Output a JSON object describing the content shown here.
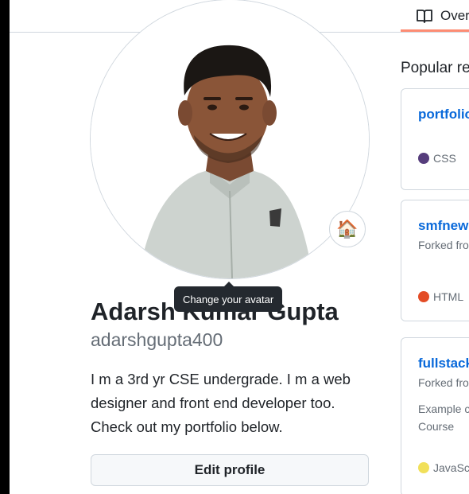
{
  "tab": {
    "label": "Overview",
    "icon": "book-icon"
  },
  "tooltip": "Change your avatar",
  "status": {
    "emoji": "🏠"
  },
  "profile": {
    "full_name": "Adarsh Kumar Gupta",
    "username": "adarshgupta400",
    "bio": "I m a 3rd yr CSE undergrade. I m a web designer and front end developer too. Check out my portfolio below.",
    "edit_label": "Edit profile"
  },
  "popular": {
    "title": "Popular repositories",
    "repos": [
      {
        "name": "portfolio",
        "forked": "",
        "description": "",
        "language": "CSS",
        "lang_color": "#563d7c"
      },
      {
        "name": "smfnew",
        "forked": "Forked from",
        "description": "",
        "language": "HTML",
        "lang_color": "#e34c26"
      },
      {
        "name": "fullstack",
        "forked": "Forked from",
        "description_line1": "Example c",
        "description_line2": "Course",
        "language": "JavaScript",
        "lang_color": "#f1e05a"
      }
    ]
  },
  "colors": {
    "link": "#0969da",
    "tab_underline": "#fd8c73",
    "tooltip_bg": "#24292f"
  }
}
